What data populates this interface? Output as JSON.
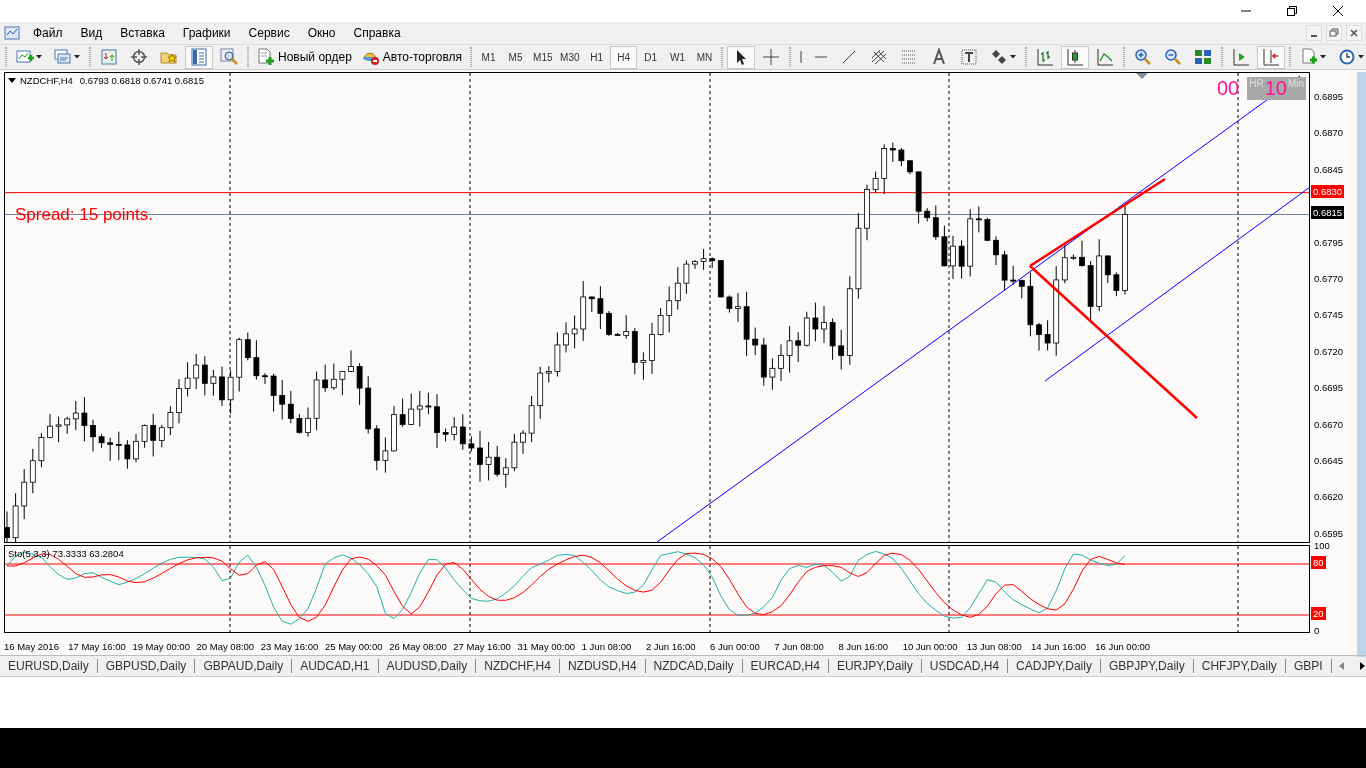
{
  "menu": [
    "Файл",
    "Вид",
    "Вставка",
    "Графики",
    "Сервис",
    "Окно",
    "Справка"
  ],
  "toolbar": {
    "icon_buttons": [
      {
        "pressed": false
      },
      {
        "pressed": false
      },
      {
        "pressed": false
      },
      {
        "pressed": false
      },
      {
        "pressed": false
      },
      {
        "pressed": true
      },
      {
        "pressed": false
      },
      {
        "pressed": true
      },
      {
        "pressed": false
      },
      {
        "pressed": false
      },
      {
        "pressed": false
      },
      {
        "pressed": false
      },
      {
        "pressed": false
      },
      {
        "pressed": false
      },
      {
        "pressed": false
      },
      {
        "pressed": false
      },
      {
        "pressed": false
      },
      {
        "pressed": false
      },
      {
        "pressed": true
      },
      {
        "pressed": false
      },
      {
        "pressed": false
      },
      {
        "pressed": false
      },
      {
        "pressed": false
      },
      {
        "pressed": false
      },
      {
        "pressed": true
      },
      {
        "pressed": false
      },
      {
        "pressed": false
      }
    ],
    "new_order": "Новый ордер",
    "auto_trading": "Авто-торговля",
    "periods": [
      {
        "label": "M1",
        "selected": false
      },
      {
        "label": "M5",
        "selected": false
      },
      {
        "label": "M15",
        "selected": false
      },
      {
        "label": "M30",
        "selected": false
      },
      {
        "label": "H1",
        "selected": false
      },
      {
        "label": "H4",
        "selected": true
      },
      {
        "label": "D1",
        "selected": false
      },
      {
        "label": "W1",
        "selected": false
      },
      {
        "label": "MN",
        "selected": false
      }
    ]
  },
  "chart": {
    "symbol": "NZDCHF,H4",
    "ohlc": "0.6793 0.6818 0.6741 0.6815",
    "spread_text": "Spread: 15 points.",
    "timer": {
      "hours": "00",
      "hours_unit": "HR",
      "minutes": "10",
      "minutes_unit": "Min"
    },
    "price_ticks": [
      "0.6895",
      "0.6870",
      "0.6845",
      "0.6795",
      "0.6770",
      "0.6745",
      "0.6720",
      "0.6695",
      "0.6670",
      "0.6645",
      "0.6620",
      "0.6595"
    ],
    "ask_label": "0.6830",
    "bid_label": "0.6815"
  },
  "stochastic": {
    "title": "Sto(5,3,3) 73.3333 63.2804",
    "levels": [
      {
        "label": "100",
        "kind": "plain"
      },
      {
        "label": "80",
        "kind": "line"
      },
      {
        "label": "20",
        "kind": "line"
      },
      {
        "label": "0",
        "kind": "plain"
      }
    ]
  },
  "time_axis": [
    "16 May 2016",
    "17 May 16:00",
    "19 May 00:00",
    "20 May 08:00",
    "23 May 16:00",
    "25 May 00:00",
    "26 May 08:00",
    "27 May 16:00",
    "31 May 00:00",
    "1 Jun 08:00",
    "2 Jun 16:00",
    "6 Jun 00:00",
    "7 Jun 08:00",
    "8 Jun 16:00",
    "10 Jun 00:00",
    "13 Jun 08:00",
    "14 Jun 16:00",
    "16 Jun 00:00"
  ],
  "tabs": [
    "EURUSD,Daily",
    "GBPUSD,Daily",
    "GBPAUD,Daily",
    "AUDCAD,H1",
    "AUDUSD,Daily",
    "NZDCHF,H4",
    "NZDUSD,H4",
    "NZDCAD,Daily",
    "EURCAD,H4",
    "EURJPY,Daily",
    "USDCAD,H4",
    "CADJPY,Daily",
    "GBPJPY,Daily",
    "CHFJPY,Daily",
    "GBPI"
  ]
}
